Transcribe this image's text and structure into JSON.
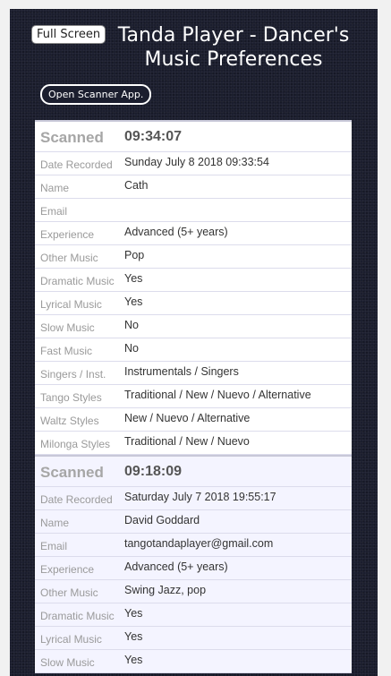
{
  "header": {
    "full_screen_label": "Full Screen",
    "title": "Tanda Player - Dancer's Music Preferences",
    "scanner_label": "Open Scanner App."
  },
  "records": [
    {
      "scanned_label": "Scanned",
      "scanned_time": "09:34:07",
      "fields": [
        {
          "label": "Date Recorded",
          "value": "Sunday July 8 2018 09:33:54"
        },
        {
          "label": "Name",
          "value": "Cath"
        },
        {
          "label": "Email",
          "value": ""
        },
        {
          "label": "Experience",
          "value": "Advanced (5+ years)"
        },
        {
          "label": "Other Music",
          "value": "Pop"
        },
        {
          "label": "Dramatic Music",
          "value": "Yes"
        },
        {
          "label": "Lyrical Music",
          "value": "Yes"
        },
        {
          "label": "Slow Music",
          "value": "No"
        },
        {
          "label": "Fast Music",
          "value": "No"
        },
        {
          "label": "Singers / Inst.",
          "value": "Instrumentals / Singers"
        },
        {
          "label": "Tango Styles",
          "value": "Traditional / New / Nuevo / Alternative"
        },
        {
          "label": "Waltz Styles",
          "value": "New / Nuevo / Alternative"
        },
        {
          "label": "Milonga Styles",
          "value": "Traditional / New / Nuevo"
        }
      ]
    },
    {
      "scanned_label": "Scanned",
      "scanned_time": "09:18:09",
      "fields": [
        {
          "label": "Date Recorded",
          "value": "Saturday July 7 2018 19:55:17"
        },
        {
          "label": "Name",
          "value": "David Goddard"
        },
        {
          "label": "Email",
          "value": "tangotandaplayer@gmail.com"
        },
        {
          "label": "Experience",
          "value": "Advanced (5+ years)"
        },
        {
          "label": "Other Music",
          "value": "Swing Jazz, pop"
        },
        {
          "label": "Dramatic Music",
          "value": "Yes"
        },
        {
          "label": "Lyrical Music",
          "value": "Yes"
        },
        {
          "label": "Slow Music",
          "value": "Yes"
        }
      ]
    }
  ]
}
